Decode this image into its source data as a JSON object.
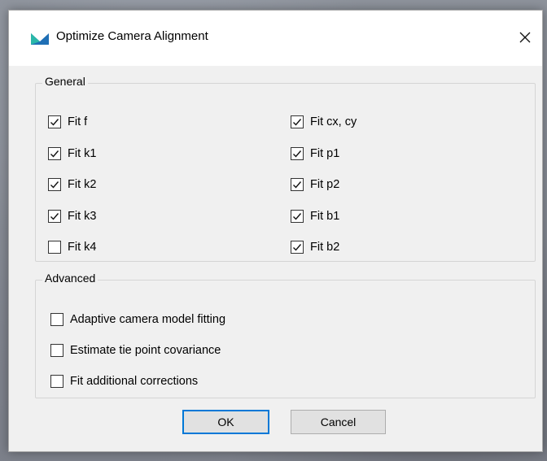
{
  "dialog": {
    "title": "Optimize Camera Alignment",
    "icon": "app-logo-icon",
    "close_icon": "close-icon"
  },
  "general": {
    "legend": "General",
    "left": [
      {
        "label": "Fit f",
        "checked": true
      },
      {
        "label": "Fit k1",
        "checked": true
      },
      {
        "label": "Fit k2",
        "checked": true
      },
      {
        "label": "Fit k3",
        "checked": true
      },
      {
        "label": "Fit k4",
        "checked": false
      }
    ],
    "right": [
      {
        "label": "Fit cx, cy",
        "checked": true
      },
      {
        "label": "Fit p1",
        "checked": true
      },
      {
        "label": "Fit p2",
        "checked": true
      },
      {
        "label": "Fit b1",
        "checked": true
      },
      {
        "label": "Fit b2",
        "checked": true
      }
    ]
  },
  "advanced": {
    "legend": "Advanced",
    "options": [
      {
        "label": "Adaptive camera model fitting",
        "checked": false
      },
      {
        "label": "Estimate tie point covariance",
        "checked": false
      },
      {
        "label": "Fit additional corrections",
        "checked": false
      }
    ]
  },
  "buttons": {
    "ok": "OK",
    "cancel": "Cancel"
  },
  "colors": {
    "accent": "#0078d7",
    "logo_teal": "#2ab7a9",
    "logo_blue": "#1f6fb5"
  }
}
